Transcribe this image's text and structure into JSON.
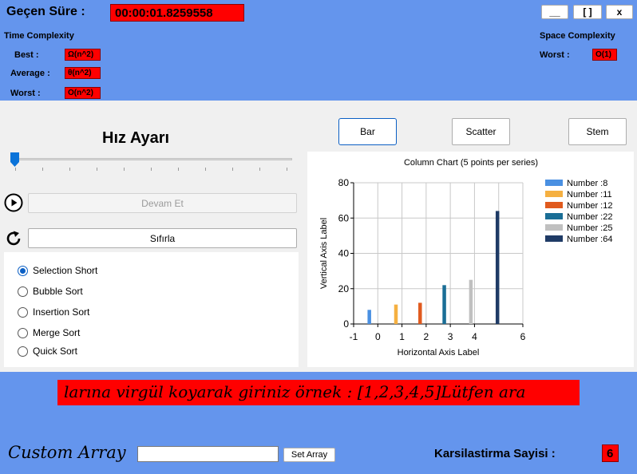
{
  "header": {
    "elapsed_label": "Geçen Süre :",
    "elapsed_value": "00:00:01.8259558",
    "window_buttons": {
      "minimize": "__",
      "maximize": "[ ]",
      "close": "x"
    },
    "time_complexity": {
      "title": "Time Complexity",
      "best_label": "Best :",
      "best_value": "Ω(n^2)",
      "average_label": "Average :",
      "average_value": "θ(n^2)",
      "worst_label": "Worst :",
      "worst_value": "O(n^2)"
    },
    "space_complexity": {
      "title": "Space Complexity",
      "worst_label": "Worst :",
      "worst_value": "O(1)"
    }
  },
  "speed": {
    "title": "Hız Ayarı",
    "slider_level": 0,
    "tick_count": 11
  },
  "controls": {
    "continue_label": "Devam Et",
    "reset_label": "Sıfırla"
  },
  "algorithms": {
    "options": [
      "Selection Short",
      "Bubble Sort",
      "Insertion Sort",
      "Merge Sort",
      "Quick Sort"
    ],
    "selected": "Selection Short"
  },
  "chart_tabs": {
    "bar": "Bar",
    "scatter": "Scatter",
    "stem": "Stem"
  },
  "chart_data": {
    "type": "bar",
    "title": "Column Chart (5 points per series)",
    "xlabel": "Horizontal Axis Label",
    "ylabel": "Vertical Axis Label",
    "xlim": [
      -1,
      6
    ],
    "ylim": [
      0,
      80
    ],
    "xticks": [
      "-1",
      "0",
      "1",
      "2",
      "3",
      "4",
      "6"
    ],
    "yticks": [
      "0",
      "20",
      "40",
      "60",
      "80"
    ],
    "grid": true,
    "legend_position": "right",
    "series": [
      {
        "name": "Number :8",
        "x": -0.35,
        "value": 8,
        "color": "#4a90e2"
      },
      {
        "name": "Number :11",
        "x": 0.75,
        "value": 11,
        "color": "#f5b041"
      },
      {
        "name": "Number :12",
        "x": 1.75,
        "value": 12,
        "color": "#e05a1e"
      },
      {
        "name": "Number :22",
        "x": 2.75,
        "value": 22,
        "color": "#1a6e96"
      },
      {
        "name": "Number :25",
        "x": 3.85,
        "value": 25,
        "color": "#c0c0c0"
      },
      {
        "name": "Number :64",
        "x": 4.95,
        "value": 64,
        "color": "#1f3b66"
      }
    ]
  },
  "banner": {
    "text": "larına virgül koyarak giriniz örnek : [1,2,3,4,5]Lütfen ara"
  },
  "footer": {
    "custom_array_label": "Custom Array",
    "custom_array_value": "",
    "set_array_label": "Set Array",
    "comparisons_label": "Karsilastirma Sayisi :",
    "comparisons_value": "6"
  },
  "colors": {
    "header_blue": "#6495ed",
    "value_red": "#ff0000",
    "accent": "#0b5fc4"
  }
}
